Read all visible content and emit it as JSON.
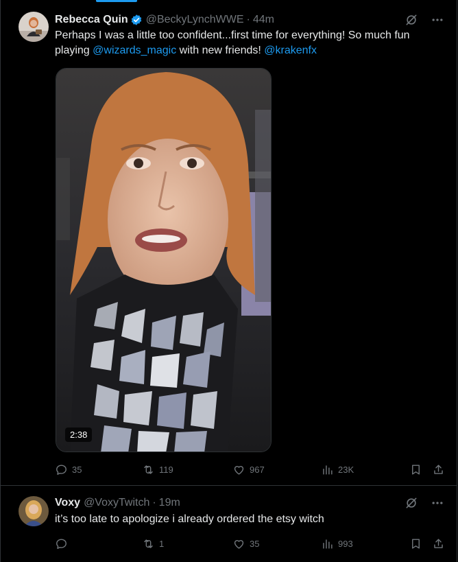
{
  "tweets": [
    {
      "name": "Rebecca Quin",
      "handle": "@BeckyLynchWWE",
      "separator": "·",
      "time": "44m",
      "text_part1": "Perhaps I was a little too confident...first time for everything! So much fun playing ",
      "mention1": "@wizards_magic",
      "text_part2": "  with new friends! ",
      "mention2": "@krakenfx",
      "video_duration": "2:38",
      "replies": "35",
      "reposts": "119",
      "likes": "967",
      "views": "23K"
    },
    {
      "name": "Voxy",
      "handle": "@VoxyTwitch",
      "separator": "·",
      "time": "19m",
      "text": "it’s too late to apologize i already ordered the etsy witch",
      "replies": "",
      "reposts": "1",
      "likes": "35",
      "views": "993"
    }
  ],
  "icons": {
    "verified": "verified-badge-icon",
    "grok": "grok-icon",
    "more": "more-icon",
    "reply": "reply-icon",
    "repost": "repost-icon",
    "like": "like-icon",
    "views": "views-icon",
    "bookmark": "bookmark-icon",
    "share": "share-icon"
  },
  "colors": {
    "background": "#000000",
    "text": "#e7e9ea",
    "muted": "#71767b",
    "accent": "#1d9bf0",
    "border": "#2f3336"
  }
}
